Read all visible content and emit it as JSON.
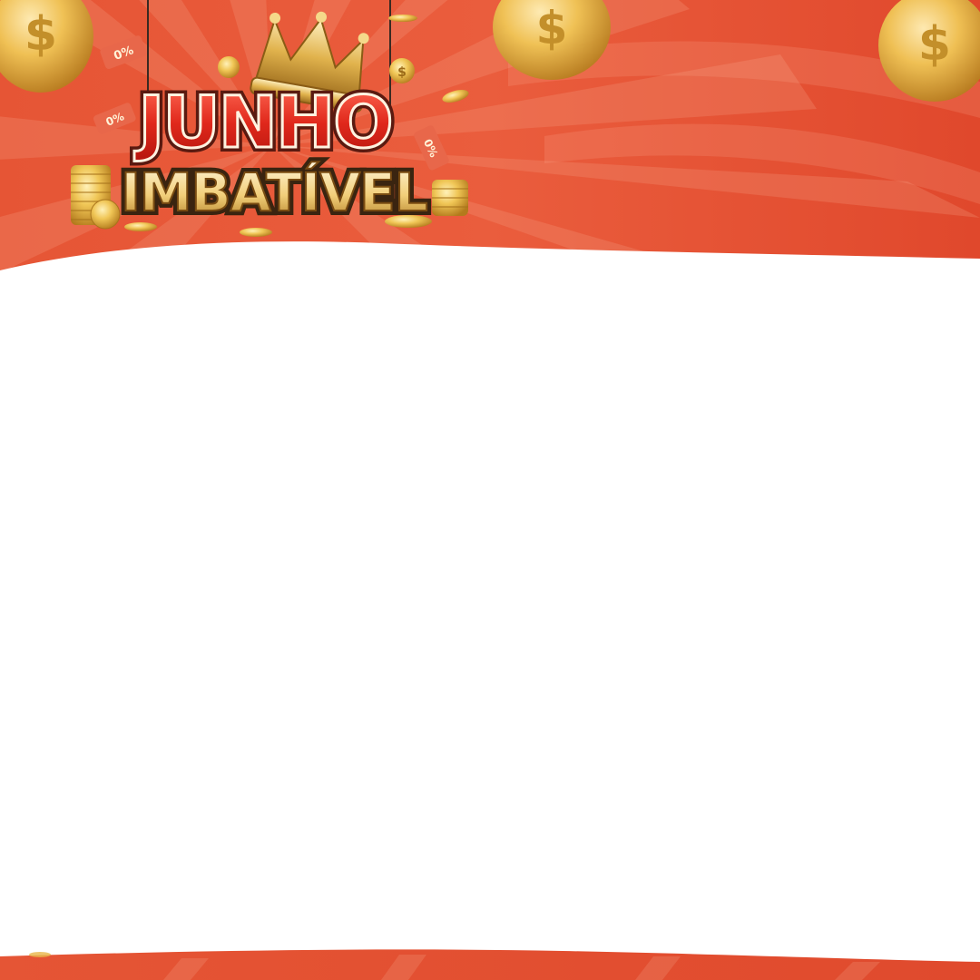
{
  "banner": {
    "title_line1": "JUNHO",
    "title_line2": "IMBATÍVEL",
    "tag_left_top": "0%",
    "tag_left_bottom": "0%",
    "tag_right": "0%"
  },
  "colors": {
    "background_orange": "#e85a3a",
    "burst_light": "#f07a5c",
    "gold": "#e8b64a",
    "gold_dark": "#b47d1e",
    "title_red": "#d82a1e",
    "white_panel": "#ffffff"
  },
  "icons": {
    "coin": "gold-dollar-coin-icon",
    "crown": "gold-crown-icon",
    "price_tag": "price-tag-icon"
  }
}
